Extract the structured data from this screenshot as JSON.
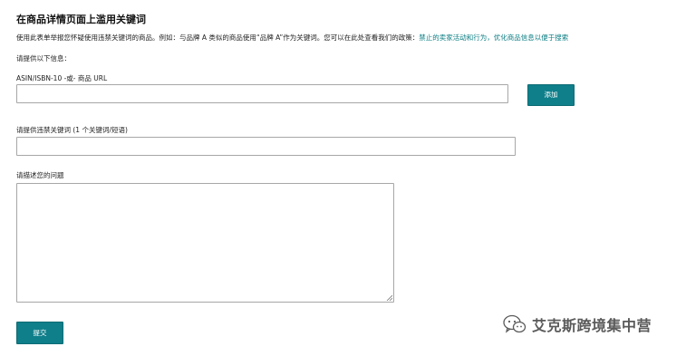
{
  "page_title": "在商品详情页面上滥用关键词",
  "description": {
    "text": "使用此表单举报您怀疑使用违禁关键词的商品。例如：与品牌 A 类似的商品使用“品牌 A”作为关键词。您可以在此处查看我们的政策：",
    "link_text": "禁止的卖家活动和行为，优化商品信息以便于搜索"
  },
  "section_label": "请提供以下信息：",
  "asin_field": {
    "label": "ASIN/ISBN-10 -或- 商品 URL",
    "value": ""
  },
  "add_button_label": "添加",
  "keyword_field": {
    "label": "请提供违禁关键词 (1 个关键词/短语)",
    "value": ""
  },
  "problem_field": {
    "label": "请描述您的问题",
    "value": ""
  },
  "submit_button_label": "提交",
  "watermark": {
    "text": "艾克斯跨境集中营",
    "icon": "wechat-icon"
  },
  "colors": {
    "button": "#0f7f8a",
    "link": "#0a7c82",
    "border": "#a7a7a7"
  }
}
